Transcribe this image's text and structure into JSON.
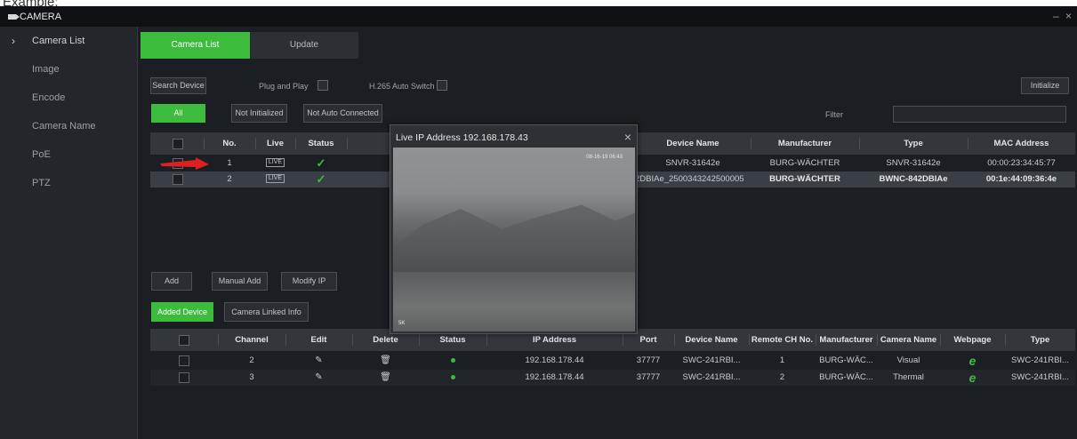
{
  "example_label": "Example:",
  "window": {
    "title": "CAMERA",
    "controls": "– ×"
  },
  "sidebar": {
    "items": [
      {
        "label": "Camera List",
        "active": true
      },
      {
        "label": "Image"
      },
      {
        "label": "Encode"
      },
      {
        "label": "Camera Name"
      },
      {
        "label": "PoE"
      },
      {
        "label": "PTZ"
      }
    ]
  },
  "tabs": [
    {
      "label": "Camera List",
      "active": true
    },
    {
      "label": "Update"
    }
  ],
  "toolbar": {
    "search_device": "Search Device",
    "plug_and_play": "Plug and Play",
    "h265_auto_switch": "H.265 Auto Switch",
    "initialize": "Initialize",
    "filter_all": "All",
    "filter_not_initialized": "Not Initialized",
    "filter_not_auto_connected": "Not Auto Connected",
    "filter_label": "Filter",
    "filter_value": ""
  },
  "search_table": {
    "headers": [
      "No.",
      "Live",
      "Status",
      "Device Name",
      "Manufacturer",
      "Type",
      "MAC Address"
    ],
    "rows": [
      {
        "no": "1",
        "live": "LIVE",
        "device_name": "SNVR-31642e",
        "manufacturer": "BURG-WÄCHTER",
        "type": "SNVR-31642e",
        "mac": "00:00:23:34:45:77"
      },
      {
        "no": "2",
        "live": "LIVE",
        "device_name": "2DBIAe_2500343242500005",
        "manufacturer": "BURG-WÄCHTER",
        "type": "BWNC-842DBIAe",
        "mac": "00:1e:44:09:36:4e"
      }
    ]
  },
  "action_buttons": {
    "add": "Add",
    "manual_add": "Manual Add",
    "modify_ip": "Modify IP"
  },
  "sub_tabs": {
    "added_device": "Added Device",
    "camera_linked_info": "Camera Linked Info"
  },
  "added_table": {
    "headers": [
      "Channel",
      "Edit",
      "Delete",
      "Status",
      "IP Address",
      "Port",
      "Device Name",
      "Remote CH No.",
      "Manufacturer",
      "Camera Name",
      "Webpage",
      "Type"
    ],
    "rows": [
      {
        "channel": "2",
        "ip": "192.168.178.44",
        "port": "37777",
        "device_name": "SWC-241RBI...",
        "remote_ch": "1",
        "manufacturer": "BURG-WÄC...",
        "camera_name": "Visual",
        "type": "SWC-241RBI..."
      },
      {
        "channel": "3",
        "ip": "192.168.178.44",
        "port": "37777",
        "device_name": "SWC-241RBI...",
        "remote_ch": "2",
        "manufacturer": "BURG-WÄC...",
        "camera_name": "Thermal",
        "type": "SWC-241RBI..."
      }
    ]
  },
  "popup": {
    "title": "Live IP Address 192.168.178.43",
    "close": "×",
    "osd_top": "08-16-19 06:43",
    "osd_bottom": "5K"
  },
  "colors": {
    "accent": "#3dbb3d",
    "background": "#1b1e22",
    "sidebar": "#23272c",
    "header": "#33373d",
    "arrow": "#e02020"
  }
}
